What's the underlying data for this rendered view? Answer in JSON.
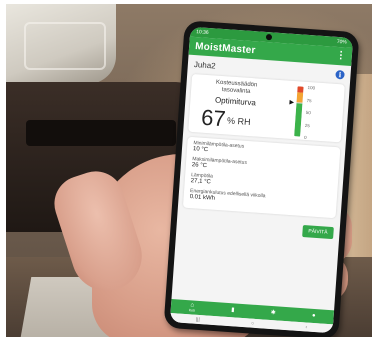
{
  "status_bar": {
    "time": "10:36",
    "right": "70%"
  },
  "app": {
    "logo_text": "MoistMaster"
  },
  "device": {
    "name": "Juha2"
  },
  "control": {
    "mode_label": "Kosteussäädön tasovalinta",
    "mode_value": "Optimiturva",
    "humidity_value": "67",
    "humidity_unit": "% RH",
    "humidity_level": 67,
    "gauge_ticks": [
      "100",
      "75",
      "50",
      "25",
      "0"
    ]
  },
  "readings": [
    {
      "label": "Minimilämpötila-asetus",
      "value": "10 °C"
    },
    {
      "label": "Maksimilämpötila-asetus",
      "value": "26 °C"
    },
    {
      "label": "Lämpötila",
      "value": "27,1 °C"
    },
    {
      "label": "Energiankulutus edellisellä viikolla",
      "value": "0.01 kWh"
    }
  ],
  "actions": {
    "save_label": "PÄIVITÄ"
  },
  "bottom_nav": [
    {
      "label": "Koti",
      "icon": "home-icon"
    },
    {
      "label": "",
      "icon": "device-icon"
    },
    {
      "label": "",
      "icon": "settings-icon"
    },
    {
      "label": "",
      "icon": "account-icon"
    }
  ],
  "colors": {
    "brand_green": "#34a84a",
    "gauge_red": "#e24a2a",
    "gauge_orange": "#f4a433",
    "gauge_green": "#3cb34a",
    "info_blue": "#2b63c7"
  }
}
